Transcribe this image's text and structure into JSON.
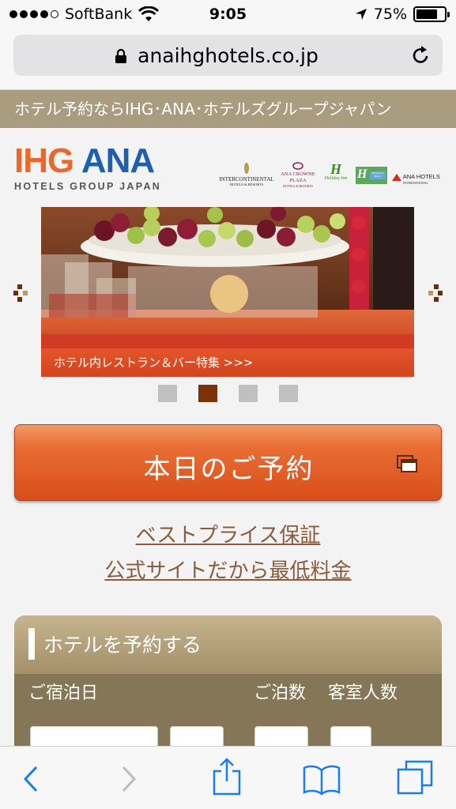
{
  "status_bar": {
    "carrier": "SoftBank",
    "time": "9:05",
    "battery": "75%",
    "battery_level": 0.75
  },
  "browser": {
    "url": "anaihghotels.co.jp"
  },
  "page": {
    "tagline": "ホテル予約ならIHG･ANA･ホテルズグループジャパン",
    "logo": {
      "main_ihg": "IHG",
      "main_ana": "ANA",
      "sub": "HOTELS GROUP JAPAN"
    },
    "brands": [
      {
        "name": "INTERCONTINENTAL",
        "sub": "HOTELS & RESORTS"
      },
      {
        "name": "ANA CROWNE PLAZA",
        "sub": "HOTELS & RESORTS"
      },
      {
        "name": "Holiday Inn",
        "sub": ""
      },
      {
        "name": "Holiday Inn Resort",
        "sub": ""
      },
      {
        "name": "ANA HOTELS",
        "sub": "INTERNATIONAL"
      }
    ],
    "slider": {
      "caption": "ホテル内レストラン＆バー特集 >>>",
      "slide_count": 4,
      "active_index": 1
    },
    "reserve_button": "本日のご予約",
    "guarantee_line1": "ベストプライス保証",
    "guarantee_line2": "公式サイトだから最低料金",
    "booking_panel": {
      "title": "ホテルを予約する",
      "checkin_label": "ご宿泊日",
      "nights_label": "ご泊数",
      "guests_label": "客室人数"
    }
  },
  "colors": {
    "accent": "#e86d34",
    "tagline_bg": "#a99c7f",
    "active_dot": "#7b3208",
    "link": "#8a5c3d",
    "ios_blue": "#1a7cf5"
  }
}
